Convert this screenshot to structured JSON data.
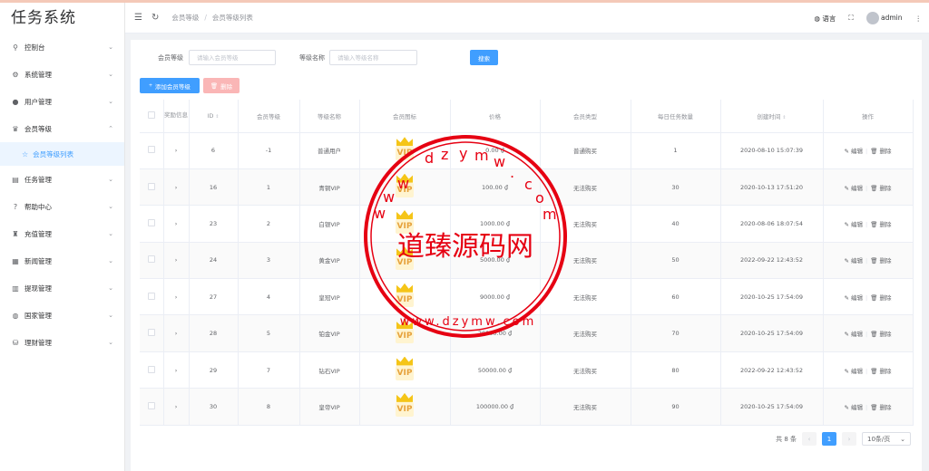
{
  "app": {
    "title": "任务系统"
  },
  "sidebar": {
    "items": [
      {
        "label": "控制台",
        "icon": "dashboard-icon"
      },
      {
        "label": "系统管理",
        "icon": "gear-icon"
      },
      {
        "label": "用户管理",
        "icon": "user-icon"
      },
      {
        "label": "会员等级",
        "icon": "crown-icon"
      },
      {
        "label": "任务管理",
        "icon": "task-icon"
      },
      {
        "label": "帮助中心",
        "icon": "help-icon"
      },
      {
        "label": "充值管理",
        "icon": "recharge-icon"
      },
      {
        "label": "新闻管理",
        "icon": "news-icon"
      },
      {
        "label": "提现管理",
        "icon": "withdraw-icon"
      },
      {
        "label": "国家管理",
        "icon": "globe-icon"
      },
      {
        "label": "理财管理",
        "icon": "finance-icon"
      }
    ],
    "sub_item": {
      "label": "会员等级列表",
      "icon": "star-icon"
    }
  },
  "topbar": {
    "breadcrumb": [
      "会员等级",
      "会员等级列表"
    ],
    "language": "语言",
    "user": "admin"
  },
  "filters": {
    "level_label": "会员等级",
    "level_placeholder": "请输入会员等级",
    "name_label": "等级名称",
    "name_placeholder": "请输入等级名称",
    "search_button": "搜索"
  },
  "actions": {
    "add_button": "添加会员等级",
    "delete_button": "删除"
  },
  "table": {
    "headers": [
      "",
      "奖励信息",
      "ID",
      "会员等级",
      "等级名称",
      "会员图标",
      "价格",
      "会员类型",
      "每日任务数量",
      "创建时间",
      "操作"
    ],
    "rows": [
      {
        "id": "6",
        "level": "-1",
        "name": "普通用户",
        "price": "0.00 ₫",
        "type": "普通购买",
        "tasks": "1",
        "created": "2020-08-10 15:07:39"
      },
      {
        "id": "16",
        "level": "1",
        "name": "青铜VIP",
        "price": "100.00 ₫",
        "type": "无法购买",
        "tasks": "30",
        "created": "2020-10-13 17:51:20"
      },
      {
        "id": "23",
        "level": "2",
        "name": "白银VIP",
        "price": "1000.00 ₫",
        "type": "无法购买",
        "tasks": "40",
        "created": "2020-08-06 18:07:54"
      },
      {
        "id": "24",
        "level": "3",
        "name": "黄金VIP",
        "price": "5000.00 ₫",
        "type": "无法购买",
        "tasks": "50",
        "created": "2022-09-22 12:43:52"
      },
      {
        "id": "27",
        "level": "4",
        "name": "皇冠VIP",
        "price": "9000.00 ₫",
        "type": "无法购买",
        "tasks": "60",
        "created": "2020-10-25 17:54:09"
      },
      {
        "id": "28",
        "level": "5",
        "name": "铂金VIP",
        "price": "20000.00 ₫",
        "type": "无法购买",
        "tasks": "70",
        "created": "2020-10-25 17:54:09"
      },
      {
        "id": "29",
        "level": "7",
        "name": "钻石VIP",
        "price": "50000.00 ₫",
        "type": "无法购买",
        "tasks": "80",
        "created": "2022-09-22 12:43:52"
      },
      {
        "id": "30",
        "level": "8",
        "name": "皇帝VIP",
        "price": "100000.00 ₫",
        "type": "无法购买",
        "tasks": "90",
        "created": "2020-10-25 17:54:09"
      }
    ],
    "icon_text": "VIP",
    "edit_label": "编辑",
    "delete_label": "删除"
  },
  "pagination": {
    "total": "共 8 条",
    "current": "1",
    "page_size": "10条/页"
  },
  "watermark": {
    "title": "道臻源码网",
    "top_letters": [
      "d",
      "z",
      "y",
      "m",
      "w",
      ".",
      "c",
      "o",
      "m"
    ],
    "left_letters": [
      "w",
      "w",
      "w"
    ],
    "bottom_text": "www.dzymw.com"
  }
}
